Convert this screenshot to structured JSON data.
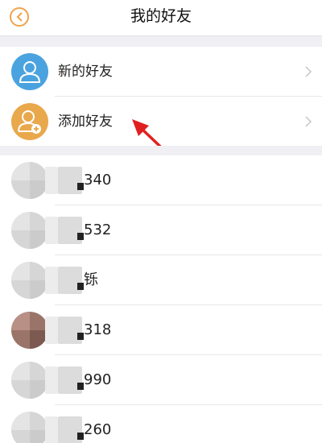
{
  "header": {
    "title": "我的好友",
    "back_icon": "back-circle-icon",
    "accent": "#f0a34a"
  },
  "menu": [
    {
      "label": "新的好友",
      "icon": "person-icon",
      "color": "#4aa3df"
    },
    {
      "label": "添加好友",
      "icon": "add-person-icon",
      "color": "#e9a84c"
    }
  ],
  "annotation": {
    "icon": "red-arrow-icon",
    "color": "#e02020"
  },
  "friends": [
    {
      "name": "340",
      "avatar": "pixelated"
    },
    {
      "name": "532",
      "avatar": "pixelated"
    },
    {
      "name": "铄",
      "avatar": "pixelated"
    },
    {
      "name": "318",
      "avatar": "pixelated-photo"
    },
    {
      "name": "990",
      "avatar": "pixelated"
    },
    {
      "name": "260",
      "avatar": "pixelated"
    }
  ]
}
